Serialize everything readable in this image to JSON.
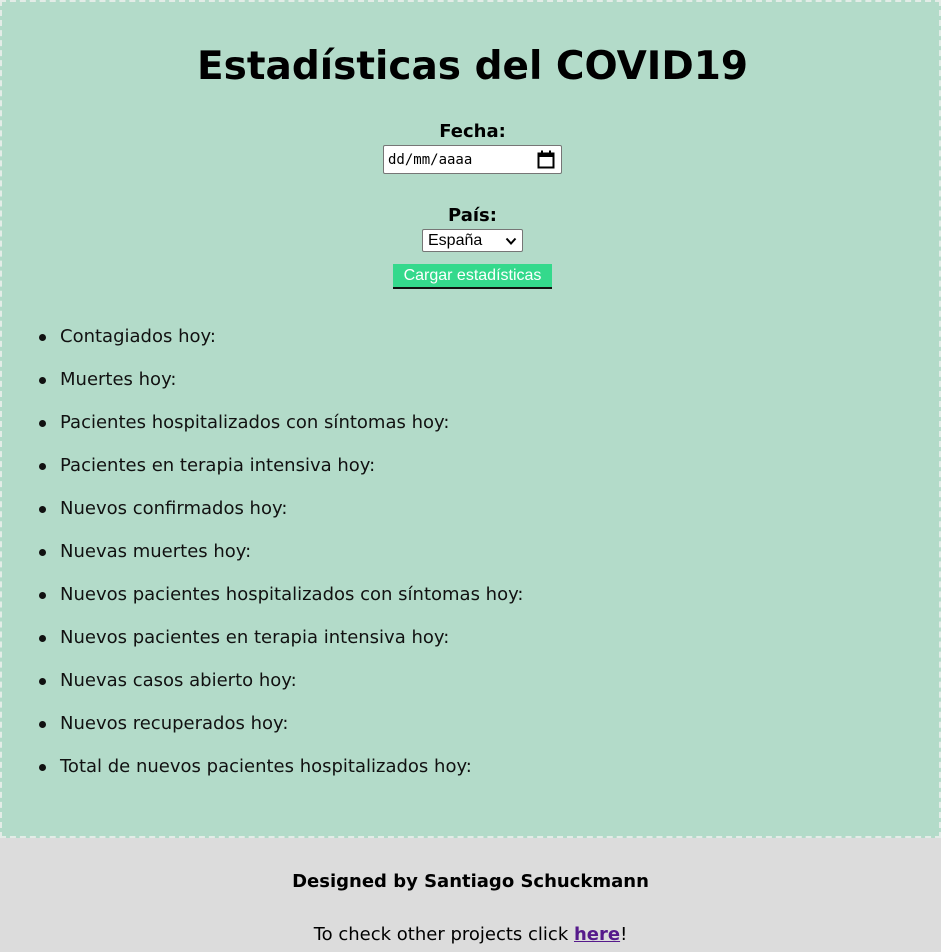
{
  "header": {
    "title": "Estadísticas del COVID19"
  },
  "form": {
    "date_label": "Fecha:",
    "date_placeholder": "dd/mm/aaaa",
    "country_label": "País:",
    "country_selected": "España",
    "submit_label": "Cargar estadísticas"
  },
  "stats": {
    "items": [
      "Contagiados hoy:",
      "Muertes hoy:",
      "Pacientes hospitalizados con síntomas hoy:",
      "Pacientes en terapia intensiva hoy:",
      "Nuevos confirmados hoy:",
      "Nuevas muertes hoy:",
      "Nuevos pacientes hospitalizados con síntomas hoy:",
      "Nuevos pacientes en terapia intensiva hoy:",
      "Nuevas casos abierto hoy:",
      "Nuevos recuperados hoy:",
      "Total de nuevos pacientes hospitalizados hoy:"
    ]
  },
  "footer": {
    "credit": "Designed by Santiago Schuckmann",
    "check_prefix": "To check other projects click ",
    "link_text": "here",
    "check_suffix": "!"
  },
  "colors": {
    "main_background": "#b3dbc9",
    "footer_background": "#dcdcdc",
    "button_background": "#34d98c",
    "link_color": "#551a8b"
  },
  "icons": {
    "date_picker": "calendar-icon",
    "select_arrow": "chevron-down-icon"
  }
}
